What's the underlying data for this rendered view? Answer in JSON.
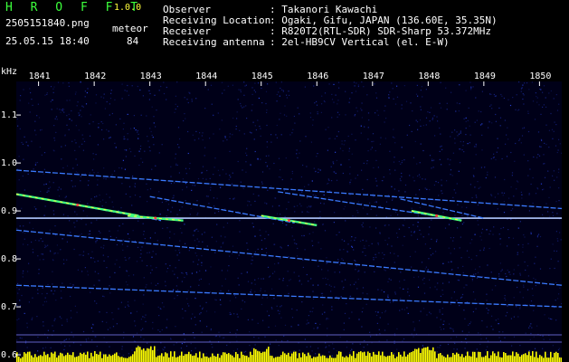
{
  "app": {
    "logo": "H R O F F T",
    "version": "1.0.0",
    "filename": "2505151840.png",
    "datetime": "25.05.15 18:40",
    "meteor_label": "meteor",
    "meteor_count": "84"
  },
  "info": [
    {
      "label": "Observer",
      "value": ": Takanori Kawachi"
    },
    {
      "label": "Receiving Location",
      "value": ": Ogaki, Gifu, JAPAN (136.60E, 35.35N)"
    },
    {
      "label": "Receiver",
      "value": ": R820T2(RTL-SDR) SDR-Sharp 53.372MHz"
    },
    {
      "label": "Receiving antenna",
      "value": ": 2el-HB9CV Vertical (el. E-W)"
    }
  ],
  "chart_data": {
    "type": "heatmap",
    "ylabel": "kHz",
    "x_ticks": [
      "1841",
      "1842",
      "1843",
      "1844",
      "1845",
      "1846",
      "1847",
      "1848",
      "1849",
      "1850"
    ],
    "y_ticks": [
      "1.1",
      "1.0",
      "0.9",
      "0.8",
      "0.7",
      "0.6"
    ],
    "y_values": [
      1.1,
      1.0,
      0.9,
      0.8,
      0.7,
      0.6
    ],
    "x_range": [
      1840.6,
      1850.4
    ],
    "y_range": [
      0.585,
      1.17
    ],
    "carrier_khz": 0.885,
    "colors": {
      "background": "#000018",
      "noise": "#1a2a9a",
      "line": "#3a7aff",
      "echo": "#ffff40",
      "hot": "#ff4040",
      "bars": "#ffff00"
    },
    "traces": [
      {
        "x": [
          1840.6,
          1850.4
        ],
        "y": [
          0.985,
          0.905
        ]
      },
      {
        "x": [
          1840.6,
          1850.4
        ],
        "y": [
          0.86,
          0.745
        ]
      },
      {
        "x": [
          1840.6,
          1850.4
        ],
        "y": [
          0.745,
          0.7
        ]
      },
      {
        "x": [
          1840.6,
          1843.2
        ],
        "y": [
          0.935,
          0.88
        ]
      },
      {
        "x": [
          1843.0,
          1845.6
        ],
        "y": [
          0.93,
          0.875
        ]
      },
      {
        "x": [
          1845.3,
          1848.1
        ],
        "y": [
          0.94,
          0.89
        ]
      },
      {
        "x": [
          1847.5,
          1849.0
        ],
        "y": [
          0.925,
          0.885
        ]
      }
    ],
    "echoes": [
      {
        "x": [
          1840.6,
          1842.8
        ],
        "y": [
          0.935,
          0.89
        ]
      },
      {
        "x": [
          1842.6,
          1843.6
        ],
        "y": [
          0.89,
          0.88
        ]
      },
      {
        "x": [
          1845.0,
          1846.0
        ],
        "y": [
          0.89,
          0.87
        ]
      },
      {
        "x": [
          1847.7,
          1848.6
        ],
        "y": [
          0.9,
          0.88
        ]
      }
    ]
  }
}
